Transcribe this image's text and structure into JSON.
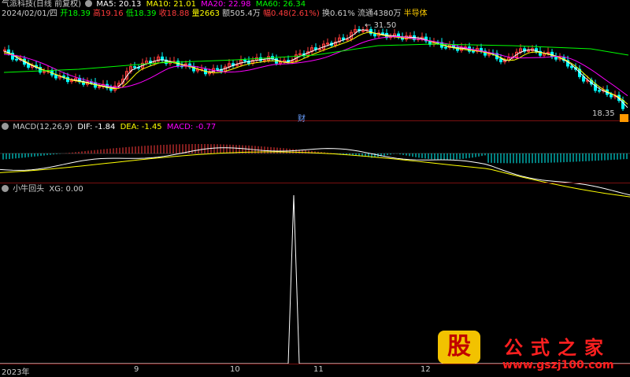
{
  "colors": {
    "up": "#ff3b3b",
    "down": "#00ffff",
    "ma5": "#ffffff",
    "ma10": "#ffff00",
    "ma20": "#ff00ff",
    "ma60": "#00ff00",
    "bg": "#000000",
    "grid": "#7a1010",
    "orange": "#ff9900"
  },
  "main_panel": {
    "title": "气派科技(日线 前复权)",
    "ma5": "MA5: 20.13",
    "ma10": "MA10: 21.01",
    "ma20": "MA20: 22.98",
    "ma60": "MA60: 26.34",
    "info": {
      "date": "2024/02/01/四",
      "open": "开18.39",
      "high": "高19.16",
      "low": "低18.39",
      "close": "收18.88",
      "volume": "量2663",
      "amount": "额505.4万",
      "change": "幅0.48(2.61%)",
      "turnover": "换0.61%",
      "float": "流通4380万",
      "sector": "半导体"
    },
    "high_label": "31.50",
    "low_label": "18.35",
    "cai_label": "财"
  },
  "macd_panel": {
    "title": "MACD(12,26,9)",
    "dif": "DIF: -1.84",
    "dea": "DEA: -1.45",
    "macd": "MACD: -0.77"
  },
  "sub_panel": {
    "title": "小牛回头",
    "xg": "XG: 0.00"
  },
  "x_axis": [
    "2023年",
    "9",
    "10",
    "11",
    "12"
  ],
  "watermark": {
    "logo_char": "股",
    "site_name": "公式之家",
    "url": "www.gszj100.com"
  }
}
